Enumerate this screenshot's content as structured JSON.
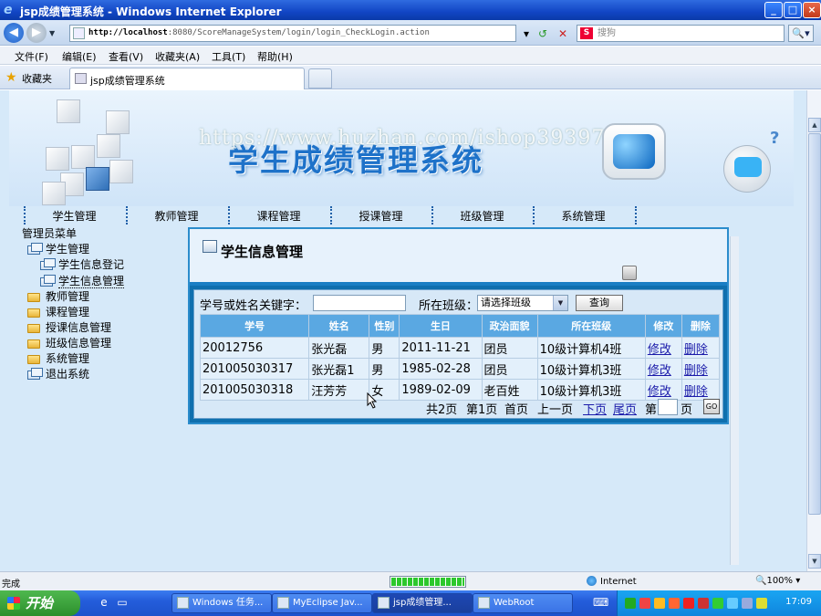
{
  "window": {
    "title": "jsp成绩管理系统 - Windows Internet Explorer",
    "minimize": "_",
    "maximize": "□",
    "close": "×"
  },
  "address": {
    "url_host": "http://localhost",
    "url_path": ":8080/ScoreManageSystem/login/login_CheckLogin.action",
    "search_placeholder": "搜狗",
    "search_engine_letter": "S",
    "go_icon": "↺",
    "stop_icon": "✕",
    "search_go": "🔍▾"
  },
  "menubar": {
    "file": "文件(F)",
    "edit": "编辑(E)",
    "view": "查看(V)",
    "favorites": "收藏夹(A)",
    "tools": "工具(T)",
    "help": "帮助(H)"
  },
  "favbar": {
    "label": "收藏夹",
    "tab_title": "jsp成绩管理系统"
  },
  "banner": {
    "title": "学生成绩管理系统",
    "watermark": "https://www.huzhan.com/ishop39397",
    "question_mark": "?"
  },
  "nav": [
    "学生管理",
    "教师管理",
    "课程管理",
    "授课管理",
    "班级管理",
    "系统管理"
  ],
  "tree": {
    "root": "管理员菜单",
    "items": [
      {
        "label": "学生管理",
        "level": 1,
        "icon": "open"
      },
      {
        "label": "学生信息登记",
        "level": 2,
        "icon": "open"
      },
      {
        "label": "学生信息管理",
        "level": 2,
        "icon": "open"
      },
      {
        "label": "教师管理",
        "level": 1,
        "icon": "folder"
      },
      {
        "label": "课程管理",
        "level": 1,
        "icon": "folder"
      },
      {
        "label": "授课信息管理",
        "level": 1,
        "icon": "folder"
      },
      {
        "label": "班级信息管理",
        "level": 1,
        "icon": "folder"
      },
      {
        "label": "系统管理",
        "level": 1,
        "icon": "folder"
      },
      {
        "label": "退出系统",
        "level": 1,
        "icon": "open"
      }
    ]
  },
  "panel": {
    "title": "学生信息管理",
    "search_label": "学号或姓名关键字：",
    "keyword_value": "",
    "class_label": "所在班级：",
    "class_selected": "请选择班级",
    "query_button": "查询"
  },
  "table": {
    "headers": [
      "学号",
      "姓名",
      "性别",
      "生日",
      "政治面貌",
      "所在班级",
      "修改",
      "删除"
    ],
    "rows": [
      [
        "20012756",
        "张光磊",
        "男",
        "2011-11-21",
        "团员",
        "10级计算机4班",
        "修改",
        "删除"
      ],
      [
        "201005030317",
        "张光磊1",
        "男",
        "1985-02-28",
        "团员",
        "10级计算机3班",
        "修改",
        "删除"
      ],
      [
        "201005030318",
        "汪芳芳",
        "女",
        "1989-02-09",
        "老百姓",
        "10级计算机3班",
        "修改",
        "删除"
      ]
    ]
  },
  "pager": {
    "total": "共2页",
    "current": "第1页",
    "first": "首页",
    "prev": "上一页",
    "next": "下页",
    "last": "尾页",
    "goto_prefix": "第",
    "goto_suffix": "页",
    "go": "GO"
  },
  "status": {
    "text": "完成",
    "zone": "Internet",
    "zoom": "🔍100%  ▾"
  },
  "taskbar": {
    "start": "开始",
    "tasks": [
      {
        "label": "Windows 任务...",
        "active": false
      },
      {
        "label": "MyEclipse Jav...",
        "active": false
      },
      {
        "label": "jsp成绩管理...",
        "active": true
      },
      {
        "label": "WebRoot",
        "active": false
      }
    ],
    "clock": "17:09"
  },
  "colors": {
    "title_bar": "#1145c4",
    "content_bg": "#d6e9f9",
    "panel_border": "#0f6fae",
    "table_header": "#5aa8e2",
    "link": "#1b1baa"
  }
}
